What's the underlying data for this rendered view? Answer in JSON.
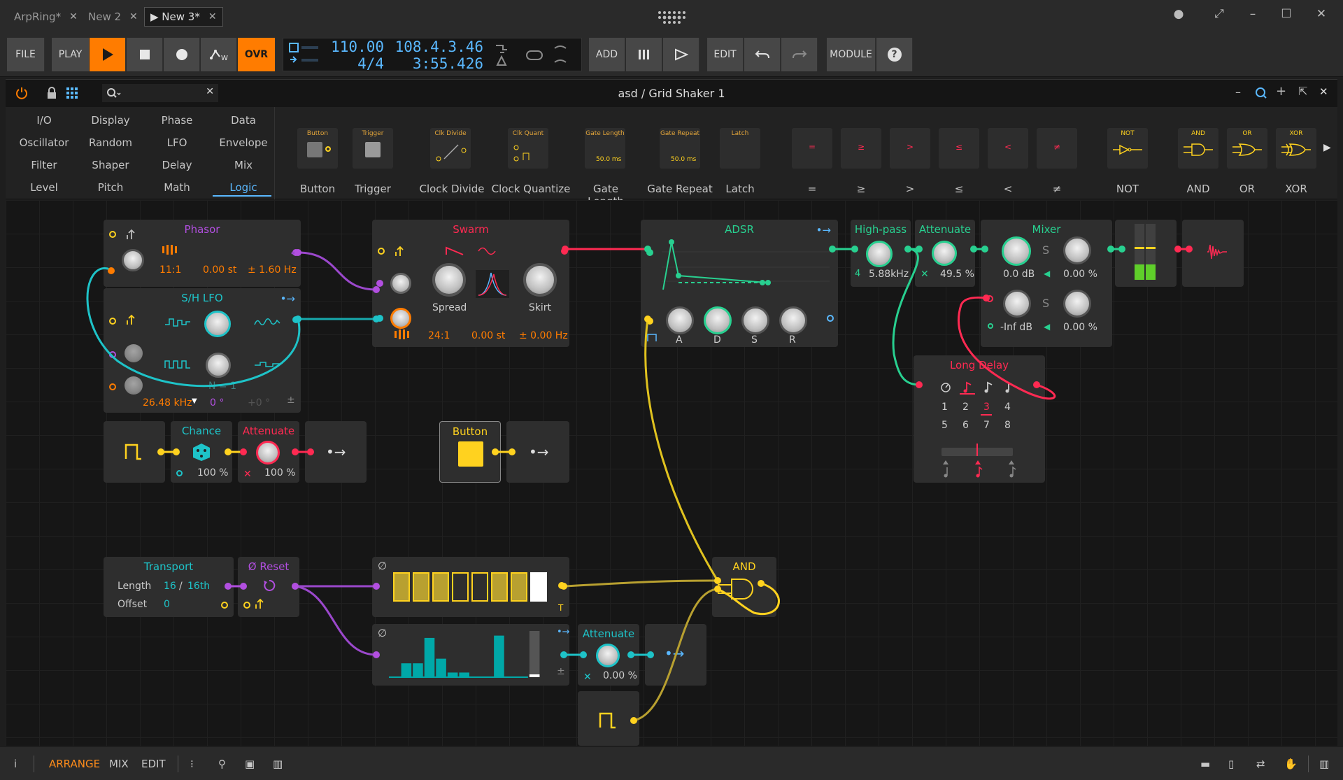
{
  "titlebar": {
    "tabs": [
      {
        "label": "ArpRing*"
      },
      {
        "label": "New 2"
      },
      {
        "label": "▶ New 3*"
      }
    ],
    "close_glyph": "✕"
  },
  "toolbar": {
    "file": "FILE",
    "play": "PLAY",
    "ovr": "OVR",
    "add": "ADD",
    "edit": "EDIT",
    "module": "MODULE",
    "help": "?",
    "tempo": "110.00",
    "signature": "4/4",
    "position": "108.4.3.46",
    "time": "3:55.426"
  },
  "device": {
    "title": "asd / Grid Shaker 1",
    "search_placeholder": ""
  },
  "browser": {
    "categories": [
      [
        "I/O",
        "Display",
        "Phase",
        "Data"
      ],
      [
        "Oscillator",
        "Random",
        "LFO",
        "Envelope"
      ],
      [
        "Filter",
        "Shaper",
        "Delay",
        "Mix"
      ],
      [
        "Level",
        "Pitch",
        "Math",
        "Logic"
      ]
    ],
    "selected": "Logic",
    "modules": [
      {
        "label": "Button",
        "thumb": "Button"
      },
      {
        "label": "Trigger",
        "thumb": "Trigger"
      },
      {
        "label": "Clock Divide",
        "thumb": "Clk Divide"
      },
      {
        "label": "Clock Quantize",
        "thumb": "Clk Quant"
      },
      {
        "label": "Gate Length",
        "thumb": "Gate Length",
        "value": "50.0 ms"
      },
      {
        "label": "Gate Repeat",
        "thumb": "Gate Repeat",
        "value": "50.0 ms"
      },
      {
        "label": "Latch",
        "thumb": "Latch"
      },
      {
        "label": "=",
        "thumb": "="
      },
      {
        "label": "≥",
        "thumb": "≥"
      },
      {
        "label": ">",
        "thumb": ">"
      },
      {
        "label": "≤",
        "thumb": "≤"
      },
      {
        "label": "<",
        "thumb": "<"
      },
      {
        "label": "≠",
        "thumb": "≠"
      },
      {
        "label": "NOT",
        "thumb": "NOT"
      },
      {
        "label": "AND",
        "thumb": "AND"
      },
      {
        "label": "OR",
        "thumb": "OR"
      },
      {
        "label": "XOR",
        "thumb": "XOR"
      }
    ]
  },
  "modules": {
    "phasor": {
      "title": "Phasor",
      "ratio": "11:1",
      "st": "0.00 st",
      "hz": "± 1.60 Hz"
    },
    "shlfo": {
      "title": "S/H LFO",
      "n": "N = 1",
      "freq": "26.48 kHz",
      "phase": "0 °",
      "offset": "+0 °"
    },
    "swarm": {
      "title": "Swarm",
      "spread": "Spread",
      "skirt": "Skirt",
      "ratio": "24:1",
      "st": "0.00 st",
      "hz": "± 0.00 Hz"
    },
    "adsr": {
      "title": "ADSR",
      "a": "A",
      "d": "D",
      "s": "S",
      "r": "R"
    },
    "highpass": {
      "title": "High-pass",
      "order": "4",
      "freq": "5.88kHz"
    },
    "attenuate1": {
      "title": "Attenuate",
      "value": "49.5 %"
    },
    "mixer": {
      "title": "Mixer",
      "db1": "0.0 dB",
      "pct1": "0.00 %",
      "db2": "-Inf dB",
      "pct2": "0.00 %",
      "s": "S"
    },
    "longdelay": {
      "title": "Long Delay",
      "nums": [
        "1",
        "2",
        "3",
        "4",
        "5",
        "6",
        "7",
        "8"
      ],
      "selected": "3"
    },
    "chance": {
      "title": "Chance",
      "value": "100 %"
    },
    "attenuate2": {
      "title": "Attenuate",
      "value": "100 %"
    },
    "button": {
      "title": "Button"
    },
    "transport": {
      "title": "Transport",
      "length_label": "Length",
      "length_value": "16",
      "length_unit": "16th",
      "offset_label": "Offset",
      "offset_value": "0"
    },
    "reset": {
      "title": "Ø Reset"
    },
    "seq1": {
      "t": "T",
      "steps": [
        1,
        1,
        1,
        0,
        0,
        1,
        1,
        2
      ]
    },
    "seq2": {
      "values": [
        0.0,
        0.3,
        0.3,
        0.85,
        0.4,
        0.1,
        0.1,
        0.0,
        0.0,
        0.9,
        0.0,
        0.0
      ]
    },
    "attenuate3": {
      "title": "Attenuate",
      "value": "0.00 %"
    },
    "and": {
      "title": "AND"
    }
  },
  "bottombar": {
    "arrange": "ARRANGE",
    "mix": "MIX",
    "edit": "EDIT"
  },
  "colors": {
    "orange": "#ff7c00",
    "blue": "#5ab8ff",
    "cyan": "#1ec3c8",
    "purple": "#b24fe0",
    "red": "#ff2a52",
    "yellow": "#ffd21f",
    "green": "#28d090",
    "teal": "#00a8a8"
  }
}
